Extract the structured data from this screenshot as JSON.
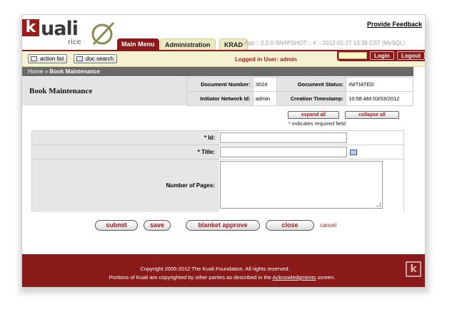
{
  "brand": {
    "logo_letter": "k",
    "logo_word": "uali",
    "logo_sub": "rice"
  },
  "header": {
    "feedback_link": "Provide Feedback",
    "tabs": [
      {
        "label": "Main Menu",
        "active": true
      },
      {
        "label": "Administration",
        "active": false
      },
      {
        "label": "KRAD",
        "active": false
      }
    ],
    "version": "App :: 2.2.0-SNAPSHOT :: # :: 2012-02-27 13:38 CST (MySQL)"
  },
  "toolbar": {
    "action_list": "action list",
    "doc_search": "doc search",
    "logged_in": "Logged in User: admin",
    "login_label": "Login",
    "logout_label": "Logout"
  },
  "breadcrumb": {
    "home": "Home",
    "separator": "»",
    "current": "Book Maintenance"
  },
  "document": {
    "title": "Book Maintenance",
    "number_label": "Document Number:",
    "number_value": "3024",
    "status_label": "Document Status:",
    "status_value": "INITIATED",
    "initiator_label": "Initiator Network Id:",
    "initiator_value": "admin",
    "timestamp_label": "Creation Timestamp:",
    "timestamp_value": "10:58 AM 03/03/2012"
  },
  "controls": {
    "expand_all": "expand all",
    "collapse_all": "collapse all",
    "required_note": "* indicates required field"
  },
  "form": {
    "id_label": "* Id:",
    "id_value": "",
    "title_label": "* Title:",
    "title_value": "",
    "pages_label": "Number of Pages:",
    "pages_value": ""
  },
  "actions": {
    "submit": "submit",
    "save": "save",
    "blanket_approve": "blanket approve",
    "close": "close",
    "cancel": "cancel"
  },
  "footer": {
    "line1": "Copyright 2005-2012 The Kuali Foundation. All rights reserved.",
    "line2_prefix": "Portions of Kuali are copyrighted by other parties as described in the",
    "line2_link": "Acknowledgments",
    "line2_suffix": "screen.",
    "logo_letter": "k"
  },
  "colors": {
    "brand_red": "#8b1a1a",
    "toolbar_yellow": "#f4f2cf",
    "label_gray": "#e6e6e6"
  }
}
